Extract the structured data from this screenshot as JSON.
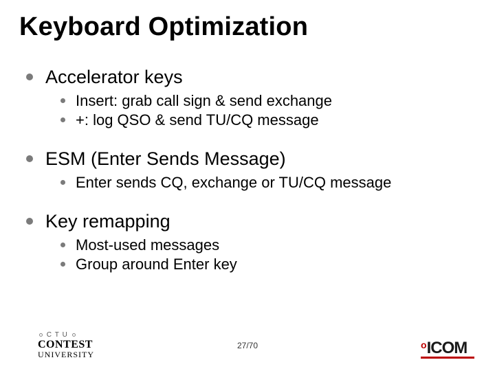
{
  "title": "Keyboard Optimization",
  "bullets": [
    {
      "label": "Accelerator keys",
      "children": [
        "Insert: grab call sign & send exchange",
        "+: log QSO & send TU/CQ message"
      ]
    },
    {
      "label": "ESM (Enter Sends Message)",
      "children": [
        "Enter sends CQ, exchange or TU/CQ message"
      ]
    },
    {
      "label": "Key remapping",
      "children": [
        "Most-used messages",
        "Group around Enter key"
      ]
    }
  ],
  "footer": {
    "left_logo": {
      "line1": "C T U",
      "line2": "CONTEST",
      "line3": "UNIVERSITY"
    },
    "page": "27/70",
    "right_logo": "ICOM"
  }
}
